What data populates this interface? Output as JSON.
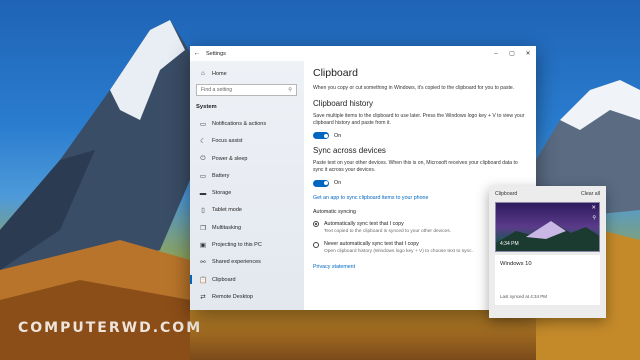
{
  "watermark": "COMPUTERWD.COM",
  "window": {
    "title": "Settings",
    "back_icon": "back-arrow-icon",
    "minimize": "–",
    "maximize": "▢",
    "close": "✕"
  },
  "sidebar": {
    "home": "Home",
    "search_placeholder": "Find a setting",
    "section": "System",
    "items": [
      {
        "label": "Notifications & actions",
        "icon": "notifications-icon",
        "glyph": "▭"
      },
      {
        "label": "Focus assist",
        "icon": "moon-icon",
        "glyph": "☾"
      },
      {
        "label": "Power & sleep",
        "icon": "power-icon",
        "glyph": "⏻"
      },
      {
        "label": "Battery",
        "icon": "battery-icon",
        "glyph": "▭"
      },
      {
        "label": "Storage",
        "icon": "storage-icon",
        "glyph": "▬"
      },
      {
        "label": "Tablet mode",
        "icon": "tablet-icon",
        "glyph": "▯"
      },
      {
        "label": "Multitasking",
        "icon": "multitasking-icon",
        "glyph": "❐"
      },
      {
        "label": "Projecting to this PC",
        "icon": "projecting-icon",
        "glyph": "▣"
      },
      {
        "label": "Shared experiences",
        "icon": "shared-icon",
        "glyph": "⚯"
      },
      {
        "label": "Clipboard",
        "icon": "clipboard-icon",
        "glyph": "📋"
      },
      {
        "label": "Remote Desktop",
        "icon": "remote-desktop-icon",
        "glyph": "⇄"
      }
    ]
  },
  "content": {
    "title": "Clipboard",
    "intro": "When you copy or cut something in Windows, it's copied to the clipboard for you to paste.",
    "history": {
      "heading": "Clipboard history",
      "desc": "Save multiple items to the clipboard to use later. Press the Windows logo key + V to view your clipboard history and paste from it.",
      "toggle_state": "On"
    },
    "sync": {
      "heading": "Sync across devices",
      "desc": "Paste text on your other devices. When this is on, Microsoft receives your clipboard data to sync it across your devices.",
      "toggle_state": "On",
      "link": "Get an app to sync clipboard items to your phone",
      "auto_label": "Automatic syncing",
      "option1": "Automatically sync text that I copy",
      "option1_desc": "Text copied to the clipboard is synced to your other devices.",
      "option2": "Never automatically sync text that I copy",
      "option2_desc": "Open clipboard history (Windows logo key + V) to choose text to sync."
    },
    "privacy_link": "Privacy statement"
  },
  "flyout": {
    "title": "Clipboard",
    "clear_all": "Clear all",
    "image_time": "4:34 PM",
    "text_item": "Windows 10",
    "last_synced": "Last synced at 4:34 PM"
  },
  "colors": {
    "accent": "#0067c0"
  }
}
